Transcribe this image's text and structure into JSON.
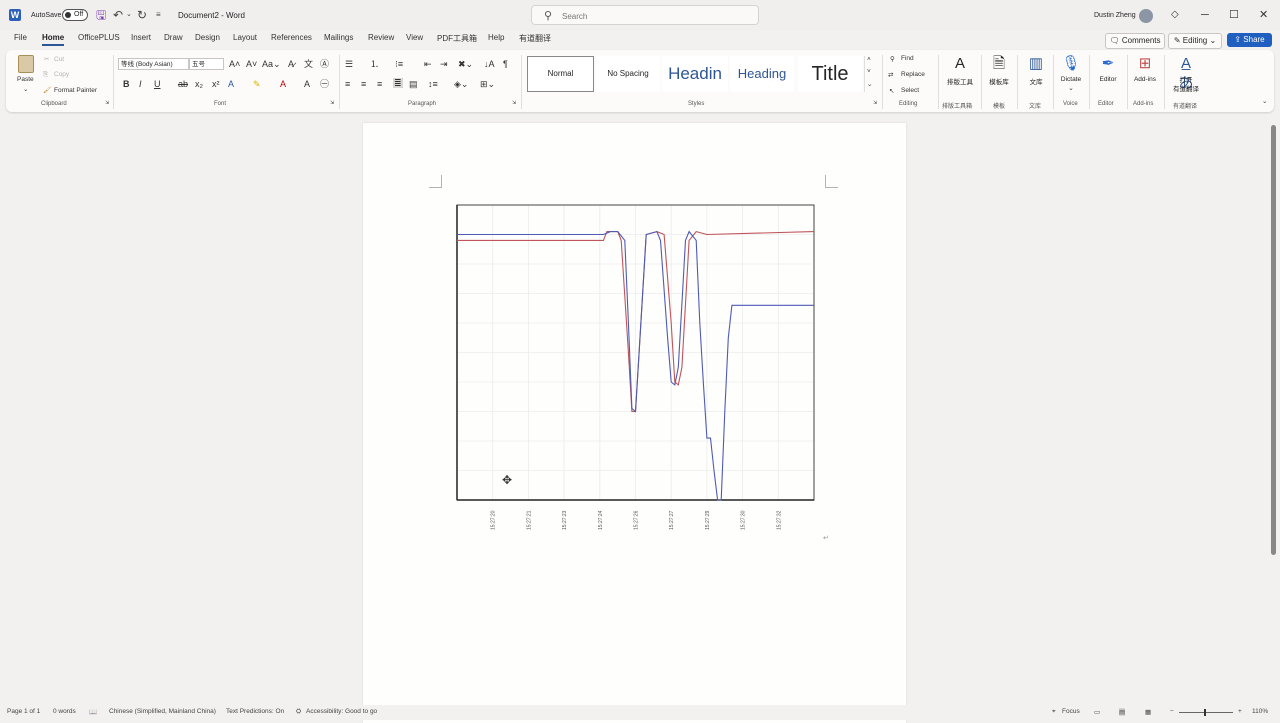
{
  "titlebar": {
    "autosave_label": "AutoSave",
    "autosave_state": "Off",
    "doc_title": "Document2  -  Word",
    "search_placeholder": "Search",
    "user_name": "Dustin Zheng"
  },
  "tabs": [
    "File",
    "Home",
    "OfficePLUS",
    "Insert",
    "Draw",
    "Design",
    "Layout",
    "References",
    "Mailings",
    "Review",
    "View",
    "PDF工具箱",
    "Help",
    "有道翻译"
  ],
  "active_tab": "Home",
  "top_right": {
    "comments": "Comments",
    "editing": "Editing",
    "share": "Share"
  },
  "ribbon": {
    "clipboard": {
      "paste": "Paste",
      "cut": "Cut",
      "copy": "Copy",
      "format_painter": "Format Painter",
      "label": "Clipboard"
    },
    "font": {
      "family": "等线 (Body Asian)",
      "size": "五号",
      "label": "Font"
    },
    "paragraph": {
      "label": "Paragraph"
    },
    "styles": {
      "normal": "Normal",
      "no_spacing": "No Spacing",
      "heading1": "Headin",
      "heading2": "Heading",
      "title": "Title",
      "label": "Styles"
    },
    "editing": {
      "find": "Find",
      "replace": "Replace",
      "select": "Select",
      "label": "Editing"
    },
    "big": [
      {
        "label": "排版工具",
        "group": "排版工具箱"
      },
      {
        "label": "模板库",
        "group": "模板"
      },
      {
        "label": "文库",
        "group": "文库"
      },
      {
        "label": "Dictate",
        "group": "Voice"
      },
      {
        "label": "Editor",
        "group": "Editor"
      },
      {
        "label": "Add-ins",
        "group": "Add-ins"
      },
      {
        "label": "打开\n有道翻译",
        "group": "有道翻译"
      }
    ]
  },
  "chart_data": {
    "type": "line",
    "x": [
      "15:27:20",
      "15:27:21",
      "15:27:23",
      "15:27:24",
      "15:27:26",
      "15:27:27",
      "15:27:29",
      "15:27:30",
      "15:27:32"
    ],
    "ylim": [
      0,
      100
    ],
    "grid": true,
    "series": [
      {
        "color": "#c0545a",
        "points": [
          [
            0,
            88
          ],
          [
            41,
            88
          ],
          [
            42,
            91
          ],
          [
            45,
            91
          ],
          [
            46,
            88
          ],
          [
            48,
            50
          ],
          [
            49,
            30
          ],
          [
            50,
            30
          ],
          [
            51,
            50
          ],
          [
            53,
            90
          ],
          [
            56,
            91
          ],
          [
            58,
            90
          ],
          [
            60,
            60
          ],
          [
            61,
            40
          ],
          [
            62,
            39
          ],
          [
            63,
            45
          ],
          [
            65,
            88
          ],
          [
            67,
            91
          ],
          [
            70,
            90
          ],
          [
            100,
            91
          ]
        ]
      },
      {
        "color": "#4d5bb5",
        "points": [
          [
            0,
            90
          ],
          [
            41,
            90
          ],
          [
            43,
            91
          ],
          [
            45,
            91
          ],
          [
            47,
            88
          ],
          [
            48,
            60
          ],
          [
            49,
            31
          ],
          [
            50,
            30
          ],
          [
            51,
            50
          ],
          [
            53,
            90
          ],
          [
            56,
            91
          ],
          [
            57,
            88
          ],
          [
            59,
            55
          ],
          [
            60,
            40
          ],
          [
            61,
            39
          ],
          [
            62,
            45
          ],
          [
            64,
            88
          ],
          [
            65,
            91
          ],
          [
            67,
            88
          ],
          [
            68,
            60
          ],
          [
            69,
            40
          ],
          [
            70,
            21
          ],
          [
            71,
            21
          ],
          [
            72,
            10
          ],
          [
            73,
            0
          ],
          [
            74,
            0
          ],
          [
            75,
            30
          ],
          [
            76,
            55
          ],
          [
            77,
            66
          ],
          [
            80,
            66
          ],
          [
            100,
            66
          ]
        ]
      }
    ]
  },
  "status": {
    "page": "Page 1 of 1",
    "words": "0 words",
    "language": "Chinese (Simplified, Mainland China)",
    "predictions": "Text Predictions: On",
    "accessibility": "Accessibility: Good to go",
    "focus": "Focus",
    "zoom": "110%"
  },
  "colors": {
    "accent": "#1e5fbf",
    "word_blue": "#2b5797"
  }
}
